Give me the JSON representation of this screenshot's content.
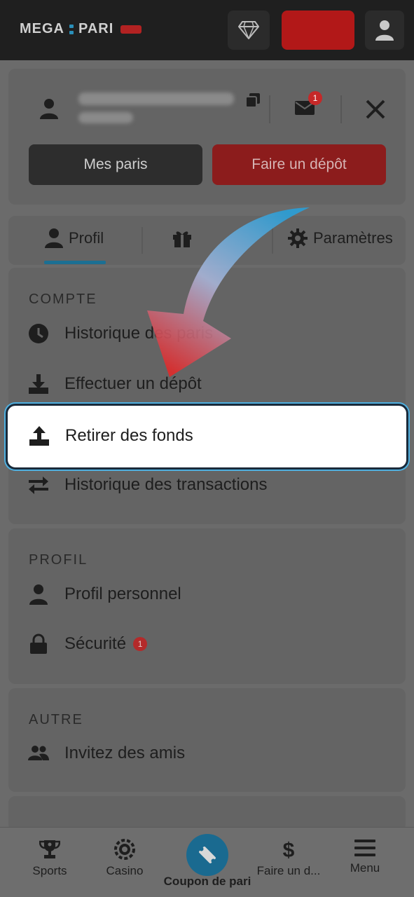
{
  "header": {
    "logo_text_left": "MEGA",
    "logo_text_right": "PARI",
    "icons": {
      "gem": "diamond-icon",
      "user": "user-icon"
    }
  },
  "account": {
    "icons": {
      "avatar": "user-icon",
      "copy": "copy-icon",
      "mail": "mail-icon",
      "close": "close-icon"
    },
    "mail_badge": "1",
    "my_bets_label": "Mes paris",
    "deposit_label": "Faire un dépôt"
  },
  "tabs": [
    {
      "label": "Profil",
      "icon": "user-icon"
    },
    {
      "label": "",
      "icon": "gift-icon"
    },
    {
      "label": "Paramètres",
      "icon": "gear-icon"
    }
  ],
  "sections": {
    "compte": {
      "title": "COMPTE",
      "items": [
        {
          "label": "Historique des paris",
          "icon": "clock-icon"
        },
        {
          "label": "Effectuer un dépôt",
          "icon": "download-icon"
        },
        {
          "label": "Retirer des fonds",
          "icon": "upload-icon"
        },
        {
          "label": "Historique des transactions",
          "icon": "transfer-arrows-icon"
        }
      ]
    },
    "profil": {
      "title": "PROFIL",
      "items": [
        {
          "label": "Profil personnel",
          "icon": "user-icon"
        },
        {
          "label": "Sécurité",
          "icon": "lock-icon",
          "badge": "1"
        }
      ]
    },
    "autre": {
      "title": "AUTRE",
      "items": [
        {
          "label": "Invitez des amis",
          "icon": "users-icon"
        }
      ]
    }
  },
  "bottom_nav": [
    {
      "label": "Sports",
      "icon": "trophy-icon"
    },
    {
      "label": "Casino",
      "icon": "chip-icon"
    },
    {
      "label": "Coupon de pari",
      "icon": "ticket-icon"
    },
    {
      "label": "Faire un d...",
      "icon": "dollar-icon"
    },
    {
      "label": "Menu",
      "icon": "hamburger-icon"
    }
  ],
  "colors": {
    "accent": "#1b6f93",
    "brand_red": "#b21818",
    "header_bg": "#1f1f1f",
    "overlay_bg": "#6b6b6b"
  }
}
